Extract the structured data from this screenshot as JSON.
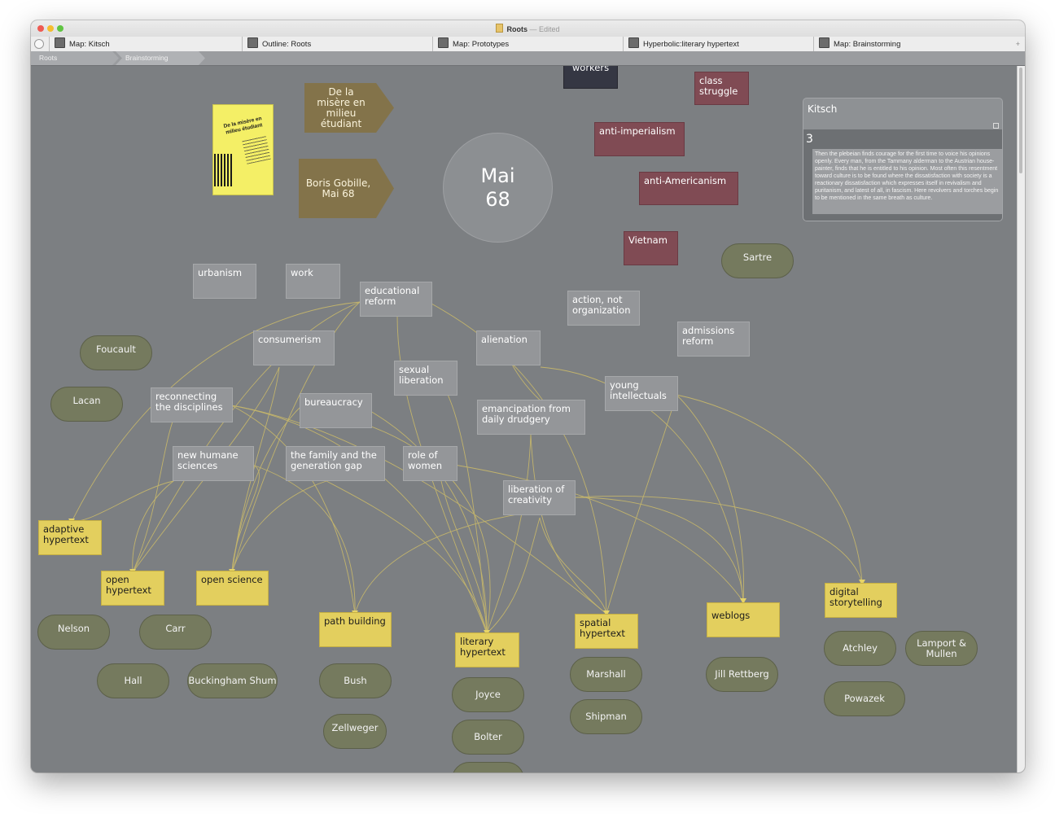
{
  "window": {
    "title": "Roots",
    "separator": "—",
    "status": "Edited"
  },
  "tabs": [
    {
      "label": "Map: Kitsch"
    },
    {
      "label": "Outline: Roots"
    },
    {
      "label": "Map: Prototypes"
    },
    {
      "label": "Hyperbolic:literary hypertext"
    },
    {
      "label": "Map: Brainstorming"
    }
  ],
  "breadcrumb": [
    "Roots",
    "Brainstorming"
  ],
  "tab_add": "+",
  "colors": {
    "canvas": "#7c7f82",
    "note": "#949699",
    "yellow_note": "#e3cf5e",
    "red_note": "#804b54",
    "pill": "#757a5e",
    "arrow_note": "#83734a",
    "link": "#c9b96a"
  },
  "map": {
    "book_cover_title": "De la misère en milieu étudiant",
    "arrows": {
      "a1": "De la misère en milieu étudiant",
      "a2": "Boris Gobille, Mai 68"
    },
    "center": "Mai 68",
    "top": {
      "workers": "workers",
      "class": "class struggle",
      "antiimp": "anti-imperialism",
      "antiam": "anti-Americanism",
      "vietnam": "Vietnam",
      "sartre": "Sartre"
    },
    "kitsch": {
      "title": "Kitsch",
      "count": "3",
      "text": "Then the plebeian finds courage for the first time to voice his opinions openly. Every man, from the Tammany alderman to the Austrian house-painter, finds that he is entitled to his opinion. Most often this resentment toward culture is to be found where the dissatisfaction with society is a reactionary dissatisfaction which expresses itself in revivalism and puritanism, and latest of all, in fascism. Here revolvers and torches begin to be mentioned in the same breath as culture."
    },
    "topics": {
      "urbanism": "urbanism",
      "work": "work",
      "educational": "educational reform",
      "action": "action, not organization",
      "admissions": "admissions reform",
      "consumerism": "consumerism",
      "alienation": "alienation",
      "sexual": "sexual liberation",
      "young": "young intellectuals",
      "reconnecting": "reconnecting the disciplines",
      "bureaucracy": "bureaucracy",
      "emancipation": "emancipation from daily drudgery",
      "humane": "new humane sciences",
      "family": "the family and the generation gap",
      "women": "role of women",
      "creativity": "liberation of creativity"
    },
    "outcomes": {
      "adaptive": "adaptive hypertext",
      "open": "open hypertext",
      "openscience": "open science",
      "path": "path building",
      "literary": "literary hypertext",
      "spatial": "spatial hypertext",
      "weblogs": "weblogs",
      "digital": "digital storytelling"
    },
    "people": {
      "foucault": "Foucault",
      "lacan": "Lacan",
      "nelson": "Nelson",
      "carr": "Carr",
      "hall": "Hall",
      "buckingham": "Buckingham Shum",
      "bush": "Bush",
      "zellweger": "Zellweger",
      "joyce": "Joyce",
      "bolter": "Bolter",
      "marshall": "Marshall",
      "shipman": "Shipman",
      "rettberg": "Jill Rettberg",
      "atchley": "Atchley",
      "lamport": "Lamport & Mullen",
      "powazek": "Powazek"
    }
  }
}
